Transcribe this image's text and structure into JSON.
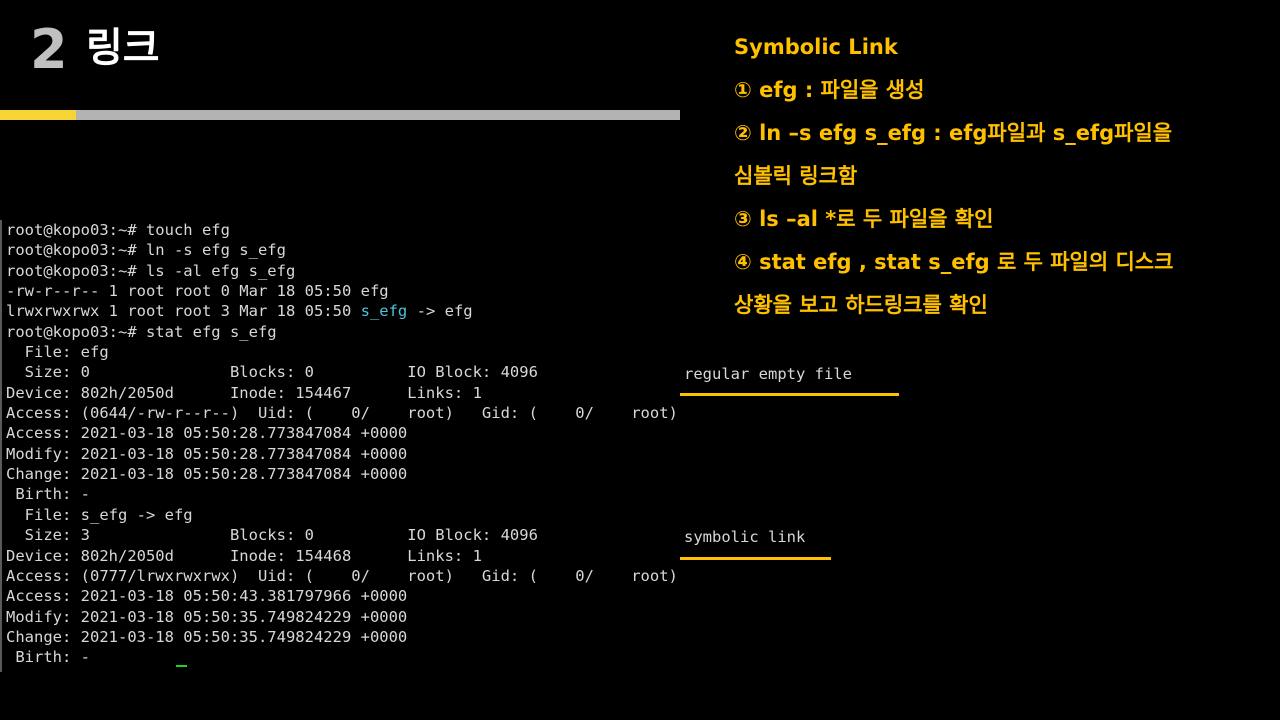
{
  "slide": {
    "number": "2",
    "title": "링크"
  },
  "notes": [
    "Symbolic Link",
    "① efg : 파일을 생성",
    "② ln –s efg s_efg : efg파일과 s_efg파일을",
    "심볼릭 링크함",
    "③ ls –al *로 두 파일을 확인",
    "④ stat efg , stat s_efg 로 두 파일의 디스크",
    "상황을 보고 하드링크를 확인"
  ],
  "terminal": {
    "lines": [
      "root@kopo03:~# touch efg",
      "root@kopo03:~# ln -s efg s_efg",
      "root@kopo03:~# ls -al efg s_efg",
      "-rw-r--r-- 1 root root 0 Mar 18 05:50 efg",
      "root@kopo03:~# stat efg s_efg",
      "  File: efg",
      "  Size: 0               Blocks: 0          IO Block: 4096",
      "Device: 802h/2050d      Inode: 154467      Links: 1",
      "Access: (0644/-rw-r--r--)  Uid: (    0/    root)   Gid: (    0/    root)",
      "Access: 2021-03-18 05:50:28.773847084 +0000",
      "Modify: 2021-03-18 05:50:28.773847084 +0000",
      "Change: 2021-03-18 05:50:28.773847084 +0000",
      " Birth: -",
      "  File: s_efg -> efg",
      "  Size: 3               Blocks: 0          IO Block: 4096",
      "Device: 802h/2050d      Inode: 154468      Links: 1",
      "Access: (0777/lrwxrwxrwx)  Uid: (    0/    root)   Gid: (    0/    root)",
      "Access: 2021-03-18 05:50:43.381797966 +0000",
      "Modify: 2021-03-18 05:50:35.749824229 +0000",
      "Change: 2021-03-18 05:50:35.749824229 +0000",
      " Birth: -"
    ],
    "symlink_line": {
      "prefix": "lrwxrwxrwx 1 root root 3 Mar 18 05:50 ",
      "link_name": "s_efg",
      "arrow": " -> efg"
    }
  },
  "annotations": {
    "regular": "regular empty file",
    "symbolic": "symbolic link"
  },
  "colors": {
    "accent": "#f7d433",
    "note_text": "#ffc000",
    "link_cyan": "#4fc3d9",
    "cursor_green": "#22d02a"
  }
}
